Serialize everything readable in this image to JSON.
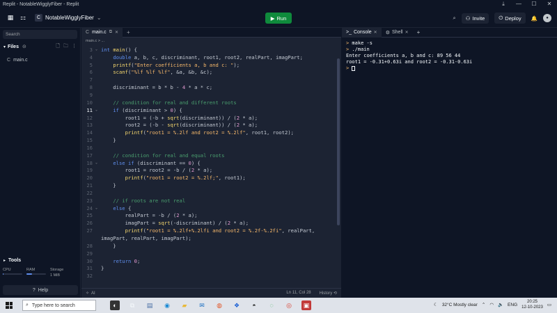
{
  "window": {
    "title": "Replit - NotableWigglyFiber - Replit"
  },
  "appbar": {
    "project_name": "NotableWigglyFiber",
    "run_label": "Run",
    "invite_label": "Invite",
    "deploy_label": "Deploy"
  },
  "sidebar": {
    "search_placeholder": "Search",
    "files_label": "Files",
    "files": [
      {
        "name": "main.c"
      }
    ],
    "tools_label": "Tools",
    "usage": [
      {
        "label": "CPU",
        "level": 0.05
      },
      {
        "label": "RAM",
        "level": 0.3
      },
      {
        "label": "Storage",
        "value": "1 MiB"
      }
    ],
    "help_label": "Help"
  },
  "editor": {
    "tab_label": "main.c",
    "breadcrumb": "main.c > ...",
    "lines": [
      {
        "n": "3",
        "fold": "v",
        "html": "<span class=\"k\">int</span> <span class=\"fn\">main</span>() {"
      },
      {
        "n": "4",
        "fold": "",
        "html": "    <span class=\"k\">double</span> a, b, c, discriminant, root1, root2, realPart, imagPart;"
      },
      {
        "n": "5",
        "fold": "",
        "html": "    <span class=\"fn\">printf</span>(<span class=\"s\">\"Enter coefficients a, b and c: \"</span>);"
      },
      {
        "n": "6",
        "fold": "",
        "html": "    <span class=\"fn\">scanf</span>(<span class=\"s\">\"%lf %lf %lf\"</span>, &a, &b, &c);"
      },
      {
        "n": "7",
        "fold": "",
        "html": ""
      },
      {
        "n": "8",
        "fold": "",
        "html": "    discriminant = b * b - <span class=\"n\">4</span> * a * c;"
      },
      {
        "n": "9",
        "fold": "",
        "html": ""
      },
      {
        "n": "10",
        "fold": "",
        "html": "    <span class=\"c\">// condition for real and different roots</span>"
      },
      {
        "n": "11",
        "fold": "v",
        "html": "    <span class=\"k\">if</span> (discriminant > <span class=\"n\">0</span>) {",
        "active": true
      },
      {
        "n": "12",
        "fold": "",
        "html": "        root1 = (-b + <span class=\"fn\">sqrt</span>(discriminant)) / (<span class=\"n\">2</span> * a);"
      },
      {
        "n": "13",
        "fold": "",
        "html": "        root2 = (-b - <span class=\"fn\">sqrt</span>(discriminant)) / (<span class=\"n\">2</span> * a);"
      },
      {
        "n": "14",
        "fold": "",
        "html": "        <span class=\"fn\">printf</span>(<span class=\"s\">\"root1 = %.2lf and root2 = %.2lf\"</span>, root1, root2);"
      },
      {
        "n": "15",
        "fold": "",
        "html": "    }"
      },
      {
        "n": "16",
        "fold": "",
        "html": ""
      },
      {
        "n": "17",
        "fold": "",
        "html": "    <span class=\"c\">// condition for real and equal roots</span>"
      },
      {
        "n": "18",
        "fold": "v",
        "html": "    <span class=\"k\">else if</span> (discriminant == <span class=\"n\">0</span>) {"
      },
      {
        "n": "19",
        "fold": "",
        "html": "        root1 = root2 = -b / (<span class=\"n\">2</span> * a);"
      },
      {
        "n": "20",
        "fold": "",
        "html": "        <span class=\"fn\">printf</span>(<span class=\"s\">\"root1 = root2 = %.2lf;\"</span>, root1);"
      },
      {
        "n": "21",
        "fold": "",
        "html": "    }"
      },
      {
        "n": "22",
        "fold": "",
        "html": ""
      },
      {
        "n": "23",
        "fold": "",
        "html": "    <span class=\"c\">// if roots are not real</span>"
      },
      {
        "n": "24",
        "fold": "v",
        "html": "    <span class=\"k\">else</span> {"
      },
      {
        "n": "25",
        "fold": "",
        "html": "        realPart = -b / (<span class=\"n\">2</span> * a);"
      },
      {
        "n": "26",
        "fold": "",
        "html": "        imagPart = <span class=\"fn\">sqrt</span>(-discriminant) / (<span class=\"n\">2</span> * a);"
      },
      {
        "n": "27",
        "fold": "",
        "html": "        <span class=\"fn\">printf</span>(<span class=\"s\">\"root1 = %.2lf+%.2lfi and root2 = %.2f-%.2fi\"</span>, realPart,"
      },
      {
        "n": "",
        "fold": "",
        "html": "imagPart, realPart, imagPart);"
      },
      {
        "n": "28",
        "fold": "",
        "html": "    }"
      },
      {
        "n": "29",
        "fold": "",
        "html": ""
      },
      {
        "n": "30",
        "fold": "",
        "html": "    <span class=\"k\">return</span> <span class=\"n\">0</span>;"
      },
      {
        "n": "31",
        "fold": "",
        "html": "}"
      },
      {
        "n": "32",
        "fold": "",
        "html": ""
      }
    ],
    "status": {
      "ai_label": "AI",
      "position": "Ln 11, Col 28",
      "history_label": "History"
    }
  },
  "console": {
    "tabs": [
      {
        "label": "Console"
      },
      {
        "label": "Shell"
      }
    ],
    "output": [
      {
        "prompt": ">",
        "text": " make -s"
      },
      {
        "prompt": ">",
        "text": " ./main"
      },
      {
        "prompt": "",
        "text": "Enter coefficients a, b and c: 89 56 44"
      },
      {
        "prompt": "",
        "text": "root1 = -0.31+0.63i and root2 = -0.31-0.63i"
      }
    ],
    "last_prompt": ">"
  },
  "taskbar": {
    "search_placeholder": "Type here to search",
    "weather": "32°C  Mostly clear",
    "language": "ENG",
    "time": "20:25",
    "date": "12-10-2023"
  }
}
